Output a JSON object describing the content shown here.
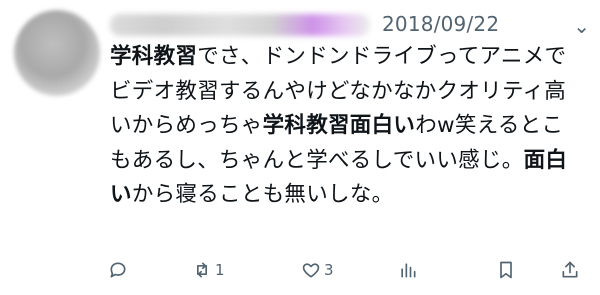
{
  "tweet": {
    "date": "2018/09/22",
    "more_glyph": "⌄",
    "text_segments": [
      {
        "t": "学科教習",
        "b": true
      },
      {
        "t": "でさ、ドンドンドライブってアニメでビデオ教習するんやけどなかなかクオリティ高いからめっちゃ",
        "b": false
      },
      {
        "t": "学科教習面白い",
        "b": true
      },
      {
        "t": "わw笑えるとこもあるし、ちゃんと学べるしでいい感じ。",
        "b": false
      },
      {
        "t": "面白い",
        "b": true
      },
      {
        "t": "から寝ることも無いしな。",
        "b": false
      }
    ]
  },
  "actions": {
    "reply": {
      "icon": "reply-icon",
      "count": ""
    },
    "retweet": {
      "icon": "retweet-icon",
      "count": "1"
    },
    "like": {
      "icon": "heart-icon",
      "count": "3"
    },
    "views": {
      "icon": "views-icon",
      "count": ""
    },
    "bookmark": {
      "icon": "bookmark-icon",
      "count": ""
    },
    "share": {
      "icon": "share-icon",
      "count": ""
    }
  },
  "colors": {
    "text": "#0f1419",
    "muted": "#536471"
  }
}
